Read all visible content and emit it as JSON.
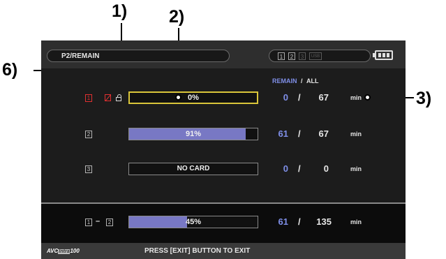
{
  "callouts": [
    "1)",
    "2)",
    "3)",
    "6)"
  ],
  "header": {
    "title": "P2/REMAIN",
    "slots": [
      "1",
      "2",
      "3",
      "USB"
    ],
    "battery_icon": "battery-icon"
  },
  "columns": {
    "remain": "REMAIN",
    "slash": "/",
    "all": "ALL"
  },
  "rows": [
    {
      "slot": "1",
      "percent": "0%",
      "fill_fraction": 0.0,
      "remain": "0",
      "all": "67",
      "unit": "min",
      "selected": true
    },
    {
      "slot": "2",
      "percent": "91%",
      "fill_fraction": 0.91,
      "remain": "61",
      "all": "67",
      "unit": "min",
      "selected": false
    },
    {
      "slot": "3",
      "percent": "NO CARD",
      "fill_fraction": 0.0,
      "remain": "0",
      "all": "0",
      "unit": "min",
      "selected": false
    }
  ],
  "total": {
    "slot_from": "1",
    "dash": "–",
    "slot_to": "2",
    "percent": "45%",
    "fill_fraction": 0.45,
    "remain": "61",
    "all": "135",
    "unit": "min"
  },
  "status": {
    "logo_avc": "AVC",
    "logo_intra": "Intra",
    "logo_num": "100",
    "message": "PRESS [EXIT] BUTTON TO EXIT"
  },
  "colors": {
    "remain": "#7f8fe8",
    "fill": "#7878c4",
    "selected_border": "#d9c53a",
    "warning": "#e03030"
  }
}
